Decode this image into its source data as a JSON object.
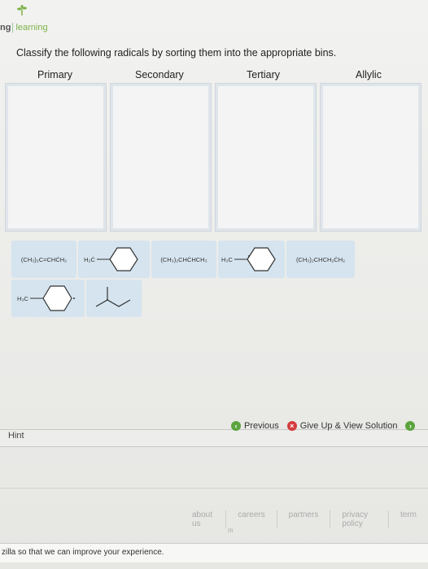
{
  "header": {
    "logo_prefix": "ng",
    "logo_text": "learning"
  },
  "question": {
    "prompt": "Classify the following radicals by sorting them into the appropriate bins."
  },
  "bins": [
    {
      "label": "Primary"
    },
    {
      "label": "Secondary"
    },
    {
      "label": "Tertiary"
    },
    {
      "label": "Allylic"
    }
  ],
  "tiles": {
    "t1_formula": "(CH₃)₂C=CHĊH₂",
    "t2_prefix": "H₂Ċ",
    "t3_formula": "(CH₃)₂CHĊHCH₃",
    "t4_prefix": "H₃C",
    "t5_formula": "(CH₃)₂CHCH₂ĊH₂",
    "t6_prefix": "H₃C"
  },
  "actions": {
    "previous": "Previous",
    "give_up": "Give Up & View Solution"
  },
  "hint": {
    "label": "Hint"
  },
  "footer": {
    "links": [
      "about us",
      "careers",
      "partners",
      "privacy policy",
      "term"
    ],
    "mark": "m"
  },
  "notification": {
    "text": "zilla so that we can improve your experience."
  }
}
